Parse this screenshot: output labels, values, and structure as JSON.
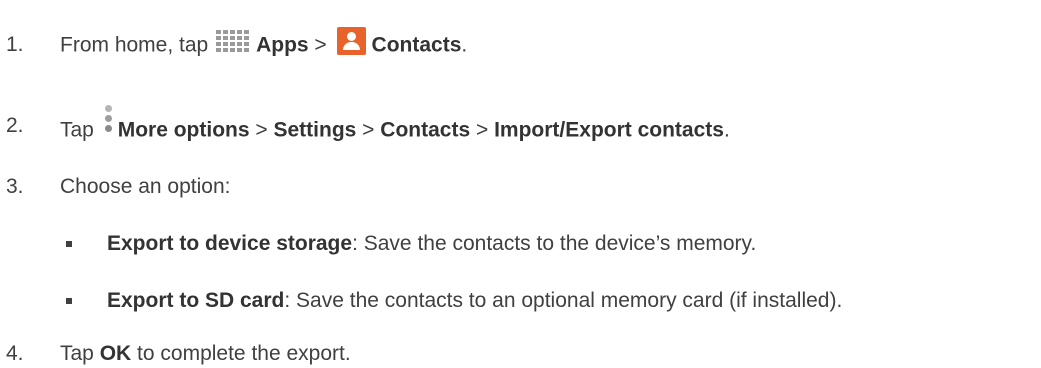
{
  "steps": [
    {
      "number": "1.",
      "from_home": "From home, tap",
      "apps": "Apps",
      "sep": ">",
      "contacts": "Contacts",
      "end": "."
    },
    {
      "number": "2.",
      "tap": "Tap",
      "more_options": "More options",
      "sep1": ">",
      "settings": "Settings",
      "sep2": ">",
      "contacts": "Contacts",
      "sep3": ">",
      "import_export": "Import/Export contacts",
      "end": "."
    },
    {
      "number": "3.",
      "text": "Choose an option:"
    },
    {
      "number": "4.",
      "tap": "Tap",
      "ok": "OK",
      "rest": "to complete the export."
    }
  ],
  "options": [
    {
      "title": "Export to device storage",
      "description": ": Save the contacts to the device’s memory."
    },
    {
      "title": "Export to SD card",
      "description": ": Save the contacts to an optional memory card (if installed)."
    }
  ],
  "icons": {
    "apps": "apps-grid-icon",
    "contacts": "contacts-icon",
    "more": "more-options-icon"
  },
  "colors": {
    "contacts_icon": "#e8632b",
    "apps_icon": "#9a9a9a",
    "more_icon_top": "#b5b5b5",
    "more_icon_bottom": "#8a8a8a"
  }
}
